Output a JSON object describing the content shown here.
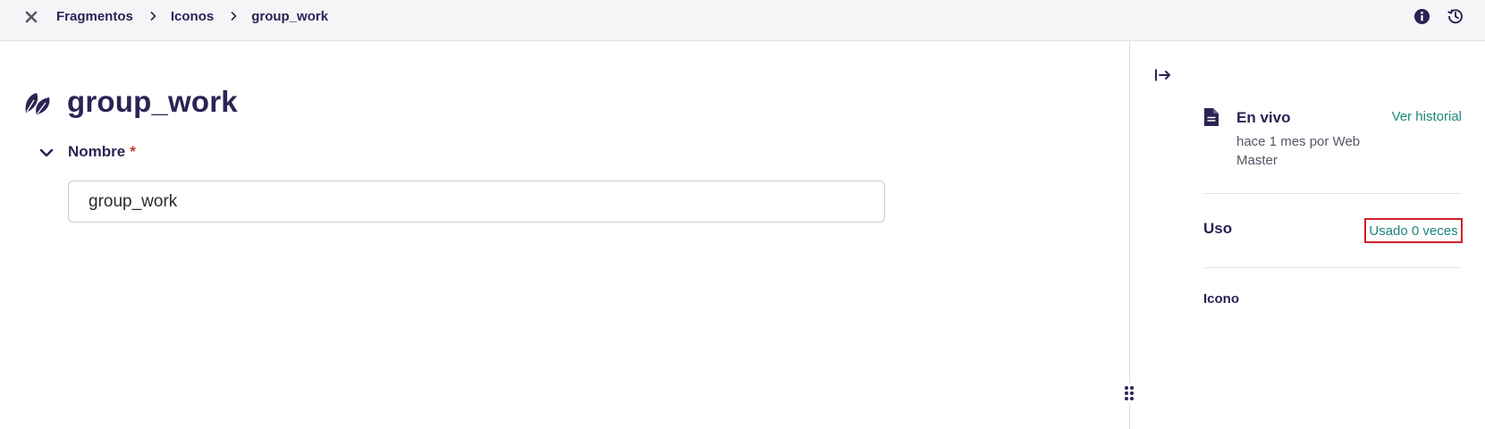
{
  "breadcrumb": {
    "items": [
      "Fragmentos",
      "Iconos",
      "group_work"
    ]
  },
  "icons": {
    "close": "close-icon",
    "separator": "chevron-right-icon",
    "info": "info-icon",
    "history": "history-icon",
    "title": "leaf-icon",
    "collapse_section": "chevron-down-icon",
    "collapse_panel": "panel-collapse-icon",
    "status": "document-icon",
    "drag": "drag-handle-icon"
  },
  "main": {
    "title": "group_work",
    "field": {
      "label": "Nombre",
      "required_marker": "*",
      "value": "group_work"
    }
  },
  "sidebar": {
    "status": {
      "title": "En vivo",
      "meta": "hace 1 mes por Web Master",
      "history_link": "Ver historial"
    },
    "usage": {
      "label": "Uso",
      "link": "Usado 0 veces"
    },
    "type": {
      "label": "Icono"
    }
  },
  "colors": {
    "primary_text": "#2a2455",
    "link": "#1a8778",
    "required": "#c0392b",
    "highlight_box": "#d0212a",
    "topbar_bg": "#f5f5f7"
  }
}
